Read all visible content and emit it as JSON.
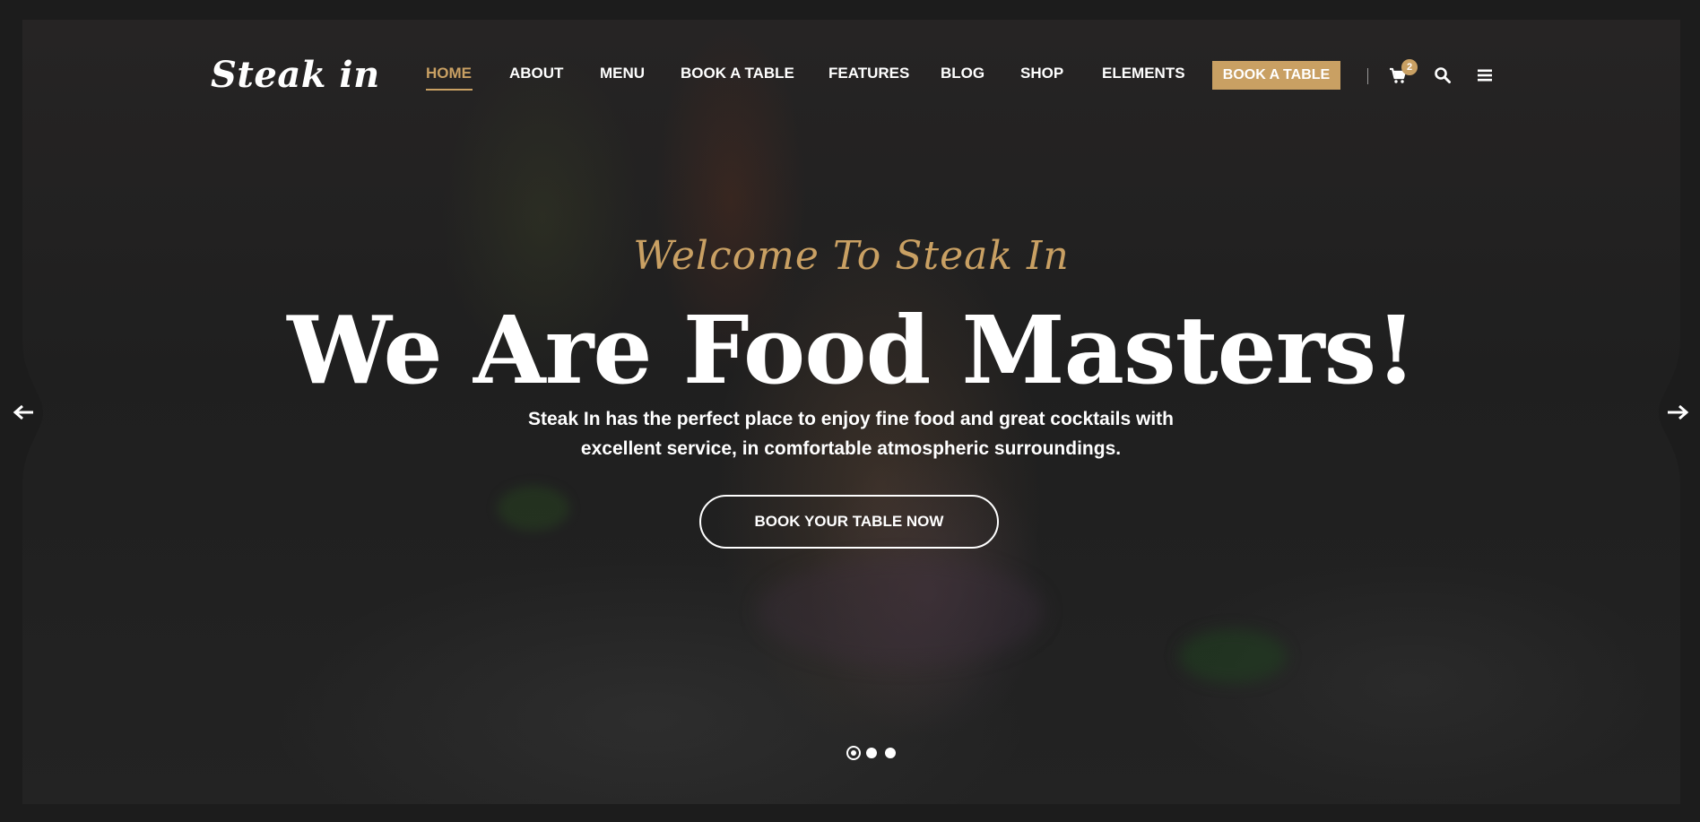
{
  "brand": {
    "logo_text": "Steak in",
    "accent_color": "#c9a063"
  },
  "nav": {
    "items": [
      {
        "label": "HOME",
        "active": true
      },
      {
        "label": "ABOUT"
      },
      {
        "label": "MENU"
      },
      {
        "label": "BOOK A TABLE"
      },
      {
        "label": "FEATURES"
      },
      {
        "label": "BLOG"
      },
      {
        "label": "SHOP"
      },
      {
        "label": "ELEMENTS"
      }
    ],
    "book_button": "BOOK A TABLE",
    "cart_count": "2",
    "icons": [
      "cart-icon",
      "search-icon",
      "menu-icon"
    ]
  },
  "hero": {
    "welcome": "Welcome To Steak In",
    "headline": "We Are Food Masters!",
    "subtext_line1": "Steak In has the perfect place to enjoy fine food and great cocktails with",
    "subtext_line2": "excellent service, in comfortable atmospheric surroundings.",
    "cta": "BOOK YOUR TABLE NOW"
  },
  "slider": {
    "dots": 3,
    "active_index": 0,
    "arrows": [
      "arrow-left-icon",
      "arrow-right-icon"
    ]
  }
}
